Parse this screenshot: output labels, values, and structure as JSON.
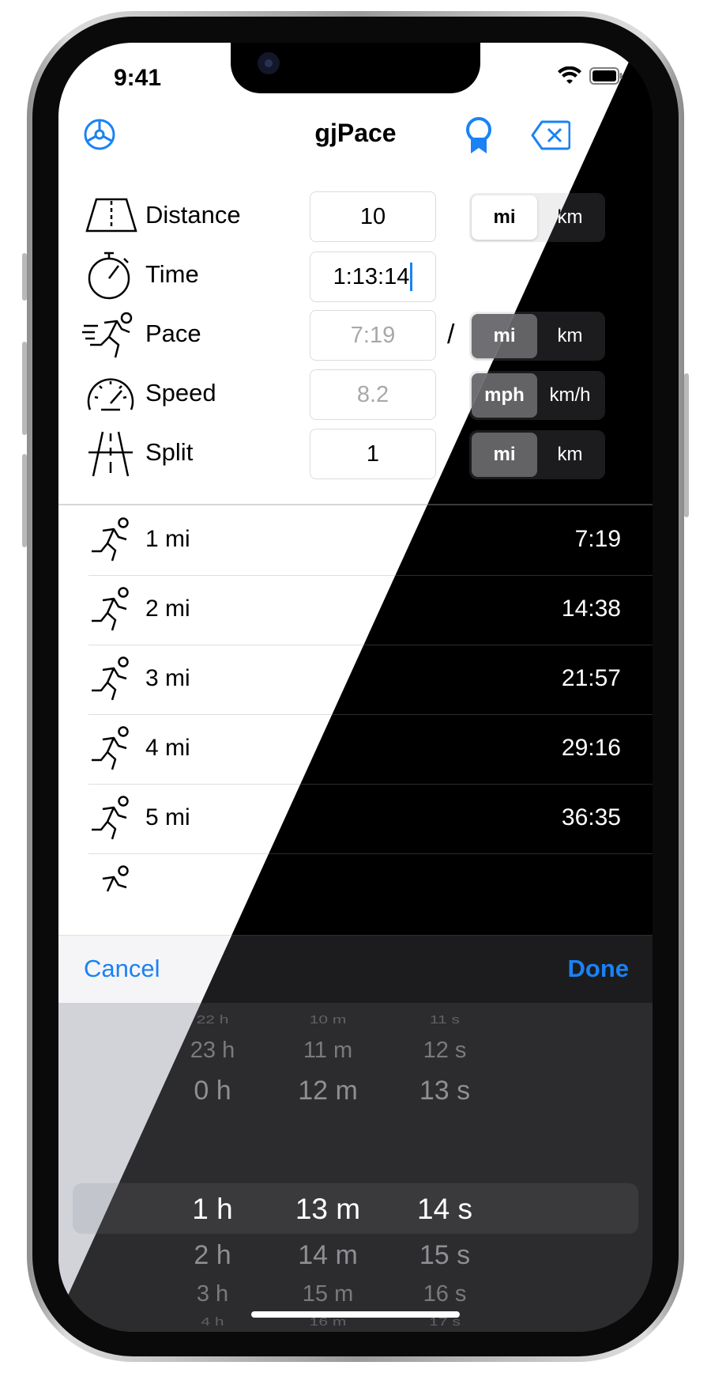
{
  "status": {
    "time": "9:41"
  },
  "app": {
    "title": "gjPace"
  },
  "inputs": {
    "distance": {
      "label": "Distance",
      "value": "10",
      "units": [
        "mi",
        "km"
      ],
      "selected": "mi"
    },
    "time": {
      "label": "Time",
      "value": "1:13:14"
    },
    "pace": {
      "label": "Pace",
      "value": "7:19",
      "separator": "/",
      "units": [
        "mi",
        "km"
      ],
      "selected": "mi"
    },
    "speed": {
      "label": "Speed",
      "value": "8.2",
      "units": [
        "mph",
        "km/h"
      ],
      "selected": "mph"
    },
    "split": {
      "label": "Split",
      "value": "1",
      "units": [
        "mi",
        "km"
      ],
      "selected": "mi"
    }
  },
  "splits": [
    {
      "label": "1 mi",
      "time": "7:19"
    },
    {
      "label": "2 mi",
      "time": "14:38"
    },
    {
      "label": "3 mi",
      "time": "21:57"
    },
    {
      "label": "4 mi",
      "time": "29:16"
    },
    {
      "label": "5 mi",
      "time": "36:35"
    }
  ],
  "toolbar": {
    "cancel": "Cancel",
    "done": "Done"
  },
  "picker": {
    "hours": [
      "22 h",
      "23 h",
      "0 h",
      "1 h",
      "2 h",
      "3 h",
      "4 h"
    ],
    "minutes": [
      "10 m",
      "11 m",
      "12 m",
      "13 m",
      "14 m",
      "15 m",
      "16 m"
    ],
    "seconds": [
      "11 s",
      "12 s",
      "13 s",
      "14 s",
      "15 s",
      "16 s",
      "17 s"
    ],
    "selected": {
      "hours": "1 h",
      "minutes": "13 m",
      "seconds": "14 s"
    }
  },
  "colors": {
    "accent": "#1a82f5",
    "light_bg": "#ffffff",
    "dark_bg": "#000000"
  },
  "icons": [
    "gear-icon",
    "award-ribbon-icon",
    "delete-backspace-icon",
    "road-icon",
    "stopwatch-icon",
    "runner-fast-icon",
    "speedometer-icon",
    "split-road-icon",
    "runner-icon",
    "wifi-icon",
    "battery-icon"
  ]
}
